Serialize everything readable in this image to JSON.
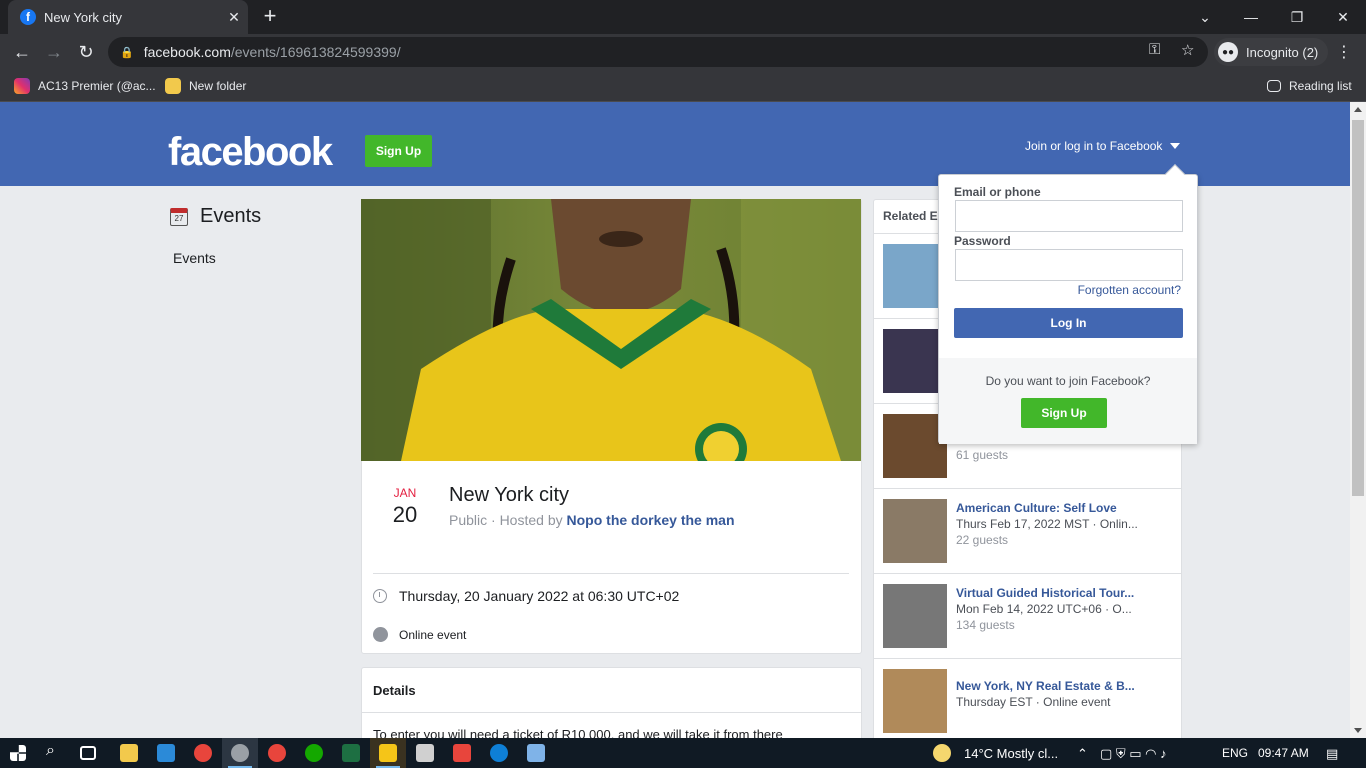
{
  "browser": {
    "tab_title": "New York city",
    "tab_close": "✕",
    "new_tab": "+",
    "url_domain": "facebook.com",
    "url_path": "/events/169613824599399/",
    "incognito_label": "Incognito (2)",
    "bookmarks": [
      {
        "label": "AC13 Premier (@ac..."
      },
      {
        "label": "New folder"
      }
    ],
    "reading_list": "Reading list"
  },
  "header": {
    "logo": "facebook",
    "signup_label": "Sign Up",
    "join_label": "Join or log in to Facebook"
  },
  "sidebar": {
    "title": "Events",
    "calendar_day": "27",
    "link": "Events"
  },
  "event": {
    "month": "JAN",
    "day": "20",
    "title": "New York city",
    "visibility": "Public · Hosted by",
    "host": "Nopo the dorkey the man",
    "datetime": "Thursday, 20 January 2022 at 06:30 UTC+02",
    "location": "Online event",
    "details_title": "Details",
    "details_text": "To enter you will need a ticket of R10 000, and we will take it from there"
  },
  "related": {
    "heading": "Related E",
    "items": [
      {
        "title": "",
        "date": "",
        "guests": "",
        "color": "#7aa6c9"
      },
      {
        "title": "",
        "date": "",
        "guests": "",
        "color": "#3a3550"
      },
      {
        "title": "",
        "date": "",
        "guests": "61 guests",
        "color": "#6b4a2e"
      },
      {
        "title": "American Culture: Self Love",
        "date": "Thurs Feb 17, 2022 MST · Onlin...",
        "guests": "22 guests",
        "color": "#8a7a66"
      },
      {
        "title": "Virtual Guided Historical Tour...",
        "date": "Mon Feb 14, 2022 UTC+06 · O...",
        "guests": "134 guests",
        "color": "#777777"
      },
      {
        "title": "New York, NY Real Estate & B...",
        "date": "Thursday EST · Online event",
        "guests": "",
        "color": "#b08a5a"
      }
    ]
  },
  "login": {
    "email_label": "Email or phone",
    "password_label": "Password",
    "forgot": "Forgotten account?",
    "login_button": "Log In",
    "join_question": "Do you want to join Facebook?",
    "signup_button": "Sign Up"
  },
  "taskbar": {
    "weather": "14°C  Mostly cl...",
    "lang": "ENG",
    "time": "09:47 AM"
  },
  "colors": {
    "fb_blue": "#4267b2",
    "green": "#42b72a",
    "link": "#365899"
  }
}
